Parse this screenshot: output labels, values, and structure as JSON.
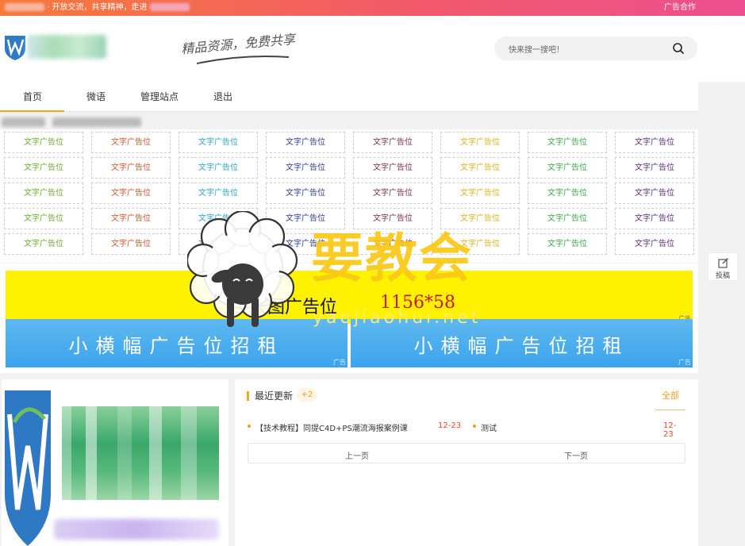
{
  "topbar": {
    "left_text": "· 开放交流，共享精神，走进",
    "right_link": "广告合作"
  },
  "header": {
    "slogan": "精品资源，免费共享",
    "search_placeholder": "快来搜一搜吧！"
  },
  "nav": {
    "items": [
      "首页",
      "微语",
      "管理站点",
      "退出"
    ],
    "active": "首页"
  },
  "text_ads": {
    "label": "文字广告位",
    "rows": 5,
    "columns": 8,
    "column_colors": [
      "#6fae2d",
      "#c8592a",
      "#2ba5c4",
      "#2d3b8c",
      "#7a2d5c",
      "#e0b020",
      "#3aa84a",
      "#5a2d7a"
    ]
  },
  "banners": {
    "large_text": "长图广告位",
    "large_size": "1156*58",
    "small_text": "小横幅广告位招租",
    "ad_tag": "广告"
  },
  "recent": {
    "title": "最近更新",
    "badge": "+2",
    "all_link": "全部",
    "items": [
      {
        "text": "【技术教程】同提C4D+PS潮流海报案例课",
        "date": "12-23"
      },
      {
        "text": "测试",
        "date": "12-23"
      }
    ],
    "prev": "上一页",
    "next": "下一页"
  },
  "sidebar_float": {
    "label": "投稿"
  },
  "watermark": {
    "text": "要教会",
    "url": "yaojiaohui.net"
  },
  "colors": {
    "accent": "#f5a623",
    "date": "#e5482d",
    "banner_yellow": "#fff200",
    "banner_blue": "#3ba4ec"
  }
}
